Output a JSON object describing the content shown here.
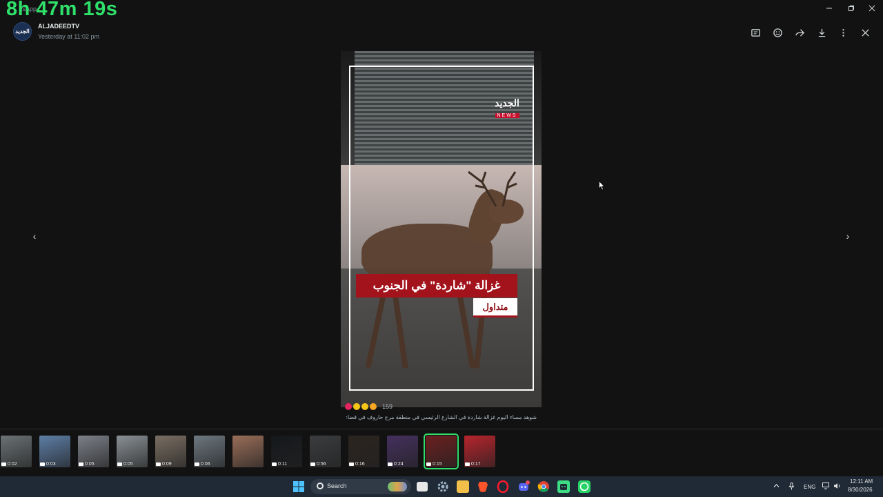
{
  "overlay": {
    "timer": "8h 47m 19s",
    "app_title_fragment": "tsApp"
  },
  "header": {
    "avatar_text": "الجديد",
    "sender": "ALJADEEDTV",
    "time": "Yesterday at 11:02 pm",
    "actions": [
      "message-icon",
      "emoji-icon",
      "forward-icon",
      "download-icon",
      "menu-icon",
      "close-icon"
    ]
  },
  "media": {
    "logo_ar": "الجديد",
    "logo_en": "NEWS",
    "caption_main": "غزالة \"شاردة\" في الجنوب",
    "caption_tag": "متداول"
  },
  "reactions": {
    "count": "159",
    "colors": [
      "#e0245e",
      "#f5c518",
      "#f5c518",
      "#f5a623"
    ]
  },
  "message_caption": "شوهد مساء اليوم غزالة شاردة في الشارع الرئيسي في منطقة مرج حاروف في قضاء النبطية",
  "nav": {
    "prev": "‹",
    "next": "›"
  },
  "thumbnails": [
    {
      "duration": "0:02",
      "color": "#6b7275"
    },
    {
      "duration": "0:03",
      "color": "#5d7ea6"
    },
    {
      "duration": "0:05",
      "color": "#7c8088"
    },
    {
      "duration": "0:05",
      "color": "#8a9095"
    },
    {
      "duration": "0:09",
      "color": "#7a6e62"
    },
    {
      "duration": "0:06",
      "color": "#6d7880"
    },
    {
      "duration": "",
      "color": "#9a6e58"
    },
    {
      "duration": "0:11",
      "color": "#15181c"
    },
    {
      "duration": "0:56",
      "color": "#3a3c3e"
    },
    {
      "duration": "0:16",
      "color": "#2b241f"
    },
    {
      "duration": "0:24",
      "color": "#45305e"
    },
    {
      "duration": "0:15",
      "color": "#6b2020"
    },
    {
      "duration": "0:17",
      "color": "#b7242c"
    }
  ],
  "taskbar": {
    "search_label": "Search",
    "tray_lang": "ENG",
    "time": "12:11 AM",
    "date": "8/30/2026"
  }
}
